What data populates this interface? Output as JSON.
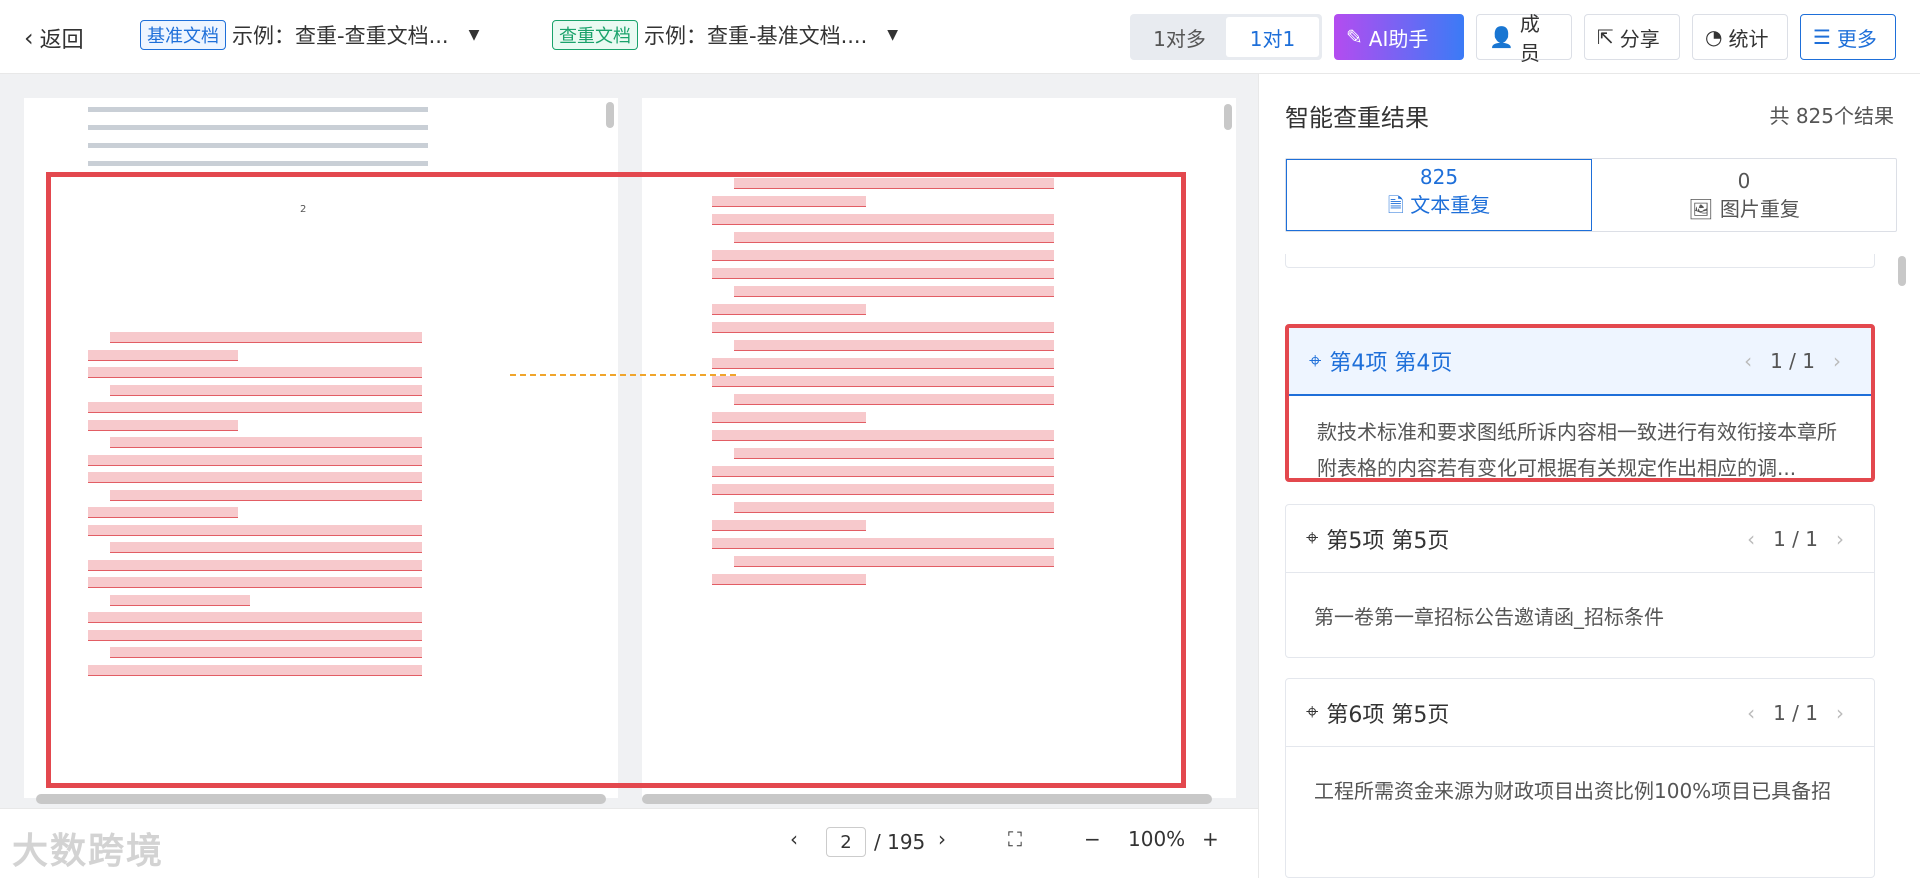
{
  "topbar": {
    "back_label": "返回",
    "base_doc_tag": "基准文档",
    "base_doc_name": "示例：查重-查重文档...",
    "check_doc_tag": "查重文档",
    "check_doc_name": "示例：查重-基准文档....",
    "mode_one_to_many": "1对多",
    "mode_one_to_one": "1对1",
    "ai_label": "AI助手",
    "members_label": "成员",
    "share_label": "分享",
    "stats_label": "统计",
    "more_label": "更多"
  },
  "viewer": {
    "page_number_marker": "2",
    "current_page": "2",
    "total_pages": "/ 195",
    "zoom": "100%"
  },
  "watermark": "大数跨境",
  "panel": {
    "title": "智能查重结果",
    "count": "共 825个结果",
    "tab_text_count": "825",
    "tab_text_label": "文本重复",
    "tab_image_count": "0",
    "tab_image_label": "图片重复",
    "cards": [
      {
        "title": "第4项 第4页",
        "pager": "1 / 1",
        "body": "款技术标准和要求图纸所诉内容相一致进行有效衔接本章所附表格的内容若有变化可根据有关规定作出相应的调..."
      },
      {
        "title": "第5项 第5页",
        "pager": "1 / 1",
        "body": "第一卷第一章招标公告邀请函_招标条件"
      },
      {
        "title": "第6项 第5页",
        "pager": "1 / 1",
        "body": "工程所需资金来源为财政项目出资比例100%项目已具备招"
      }
    ]
  },
  "colors": {
    "accent": "#1e6fd9",
    "highlight_red": "#e3484e",
    "connector": "#f0a52b"
  }
}
